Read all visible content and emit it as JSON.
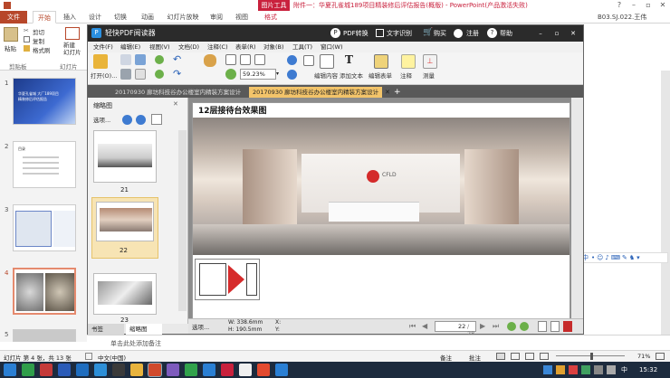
{
  "ppt": {
    "context_tab": "图片工具",
    "title": "附件一：华夏孔雀城189项目精装修后评估报告(概版) - PowerPoint(产品激活失败)",
    "tabs": [
      "文件",
      "开始",
      "插入",
      "设计",
      "切换",
      "动画",
      "幻灯片放映",
      "审阅",
      "视图",
      "格式"
    ],
    "user": "B03.SJ.022.王伟",
    "ribbon": {
      "paste": "粘贴",
      "cut": "剪切",
      "copy": "复制",
      "format_painter": "格式刷",
      "new_slide": "新建\n幻灯片",
      "clipboard_group": "剪贴板",
      "slides_group": "幻灯片"
    },
    "slides": [
      {
        "num": "1",
        "text": "华夏孔雀城 大厂189项目精装修后评估报告"
      },
      {
        "num": "2",
        "text": "目录"
      },
      {
        "num": "3",
        "text": ""
      },
      {
        "num": "4",
        "text": ""
      },
      {
        "num": "5",
        "text": ""
      }
    ],
    "notes_placeholder": "单击此处添加备注",
    "status": {
      "slide_info": "幻灯片 第 4 张，共 13 张",
      "language": "中文(中国)",
      "notes": "备注",
      "comments": "批注",
      "zoom": "71%"
    }
  },
  "pdf": {
    "app_name": "轻快PDF阅读器",
    "title_actions": [
      "PDF转换",
      "文字识别",
      "购买",
      "注册",
      "帮助"
    ],
    "menu": [
      "文件(F)",
      "编辑(E)",
      "视图(V)",
      "文档(D)",
      "注释(C)",
      "表单(R)",
      "对象(B)",
      "工具(T)",
      "窗口(W)"
    ],
    "toolbar": {
      "open": "打开(O)...",
      "zoom": "59.23%",
      "edit_content": "编辑内容",
      "add_text": "添加文本",
      "edit_form": "编辑表单",
      "annotate": "注释",
      "measure": "测量"
    },
    "tabs": [
      "20170930 廊坊科技谷办公楼室内精装方案设计",
      "20170930 廊坊科技谷办公楼室内精装方案设计"
    ],
    "side": {
      "title": "缩略图",
      "options": "选项...",
      "pages": [
        "21",
        "22",
        "23"
      ],
      "tab_bookmarks": "书签",
      "tab_thumbs": "缩略图"
    },
    "page": {
      "heading": "12层接待台效果图",
      "logo": "CFLD"
    },
    "status": {
      "options": "选项...",
      "width": "W: 338.6mm",
      "height": "H: 190.5mm",
      "x": "X:",
      "y": "Y:",
      "page_current": "22",
      "page_total": "/ 28"
    }
  },
  "taskbar": {
    "time": "15:32",
    "lang": "中"
  },
  "colors": {
    "ppt_accent": "#b7472a",
    "context_red": "#c9213d",
    "pdf_titlebar": "#2b2b2b",
    "pdf_tab_active": "#f3c46a",
    "taskbar": "#1d2b3e"
  }
}
